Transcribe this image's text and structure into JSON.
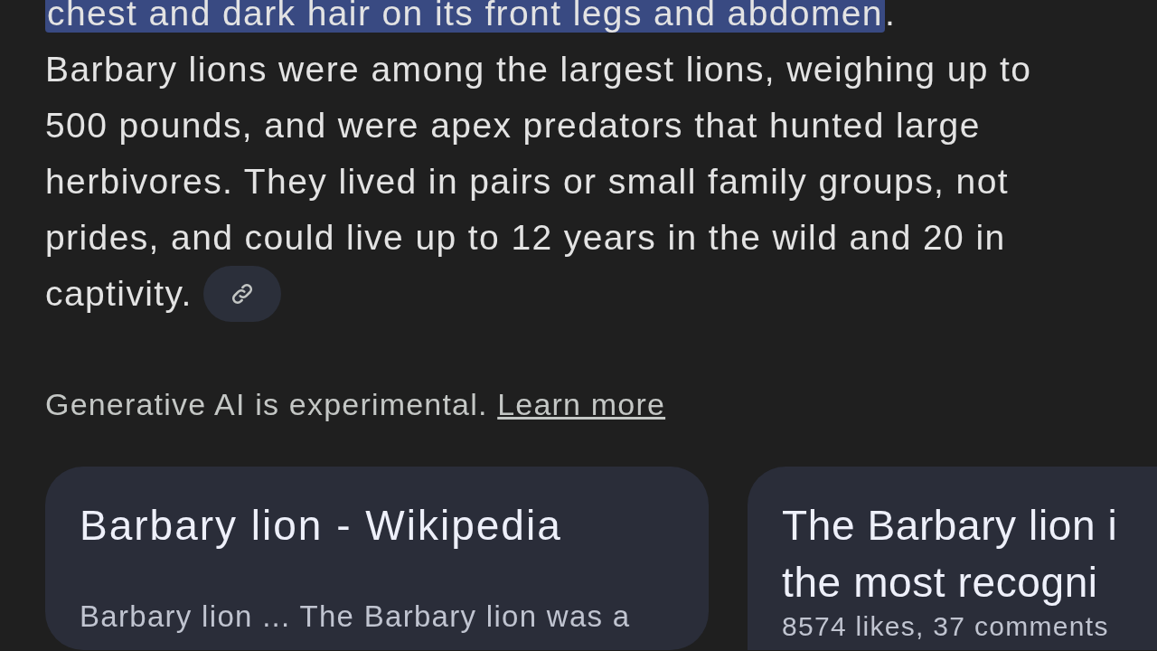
{
  "overview": {
    "highlighted_text": "chest and dark hair on its front legs and abdomen",
    "trailing_text": ".",
    "paragraph_lines": [
      "Barbary lions were among the largest lions, weighing up to",
      "500 pounds, and were apex predators that hunted large",
      "herbivores. They lived in pairs or small family groups, not",
      "prides, and could live up to 12 years in the wild and 20 in",
      "captivity."
    ]
  },
  "disclaimer": {
    "text": "Generative AI is experimental.",
    "link": "Learn more"
  },
  "source_cards": [
    {
      "title_lines": [
        "Barbary lion - Wikipedia"
      ],
      "snippet": "Barbary lion ... The Barbary lion was a"
    },
    {
      "title_lines": [
        "The Barbary lion i",
        "the most recogni"
      ],
      "snippet": "8574 likes, 37 comments"
    }
  ]
}
